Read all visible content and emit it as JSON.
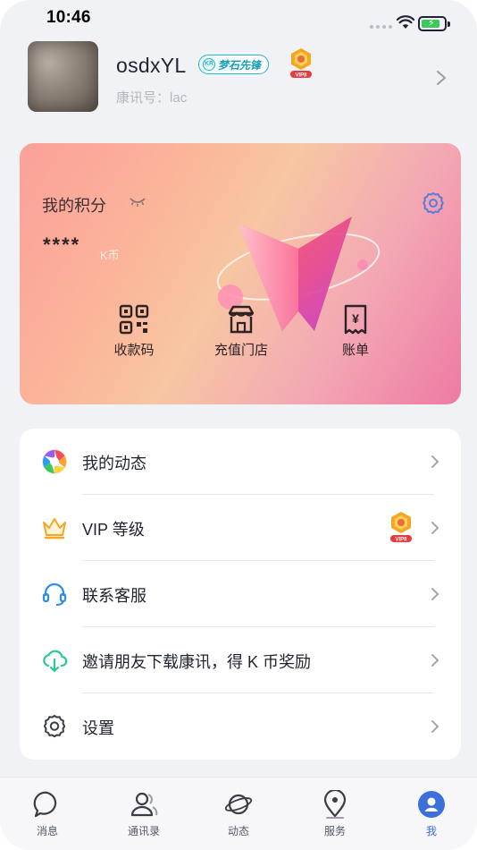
{
  "status_bar": {
    "time": "10:46"
  },
  "profile": {
    "username": "osdxYL",
    "badge_pioneer_label": "梦石先锋",
    "badge_pioneer_icon_text": "KR",
    "vip_badge_text": "VIP8",
    "account_label": "康讯号：",
    "account_value": "lac"
  },
  "points_card": {
    "title": "我的积分",
    "value": "****",
    "unit": "K币",
    "actions": [
      {
        "label": "收款码",
        "icon": "qr-code-icon"
      },
      {
        "label": "充值门店",
        "icon": "store-icon"
      },
      {
        "label": "账单",
        "icon": "receipt-icon"
      }
    ]
  },
  "menu": {
    "items": [
      {
        "label": "我的动态",
        "icon": "aperture-icon"
      },
      {
        "label": "VIP 等级",
        "icon": "crown-icon",
        "badge": "VIP8"
      },
      {
        "label": "联系客服",
        "icon": "headset-icon"
      },
      {
        "label": "邀请朋友下载康讯，得 K 币奖励",
        "icon": "cloud-download-icon"
      },
      {
        "label": "设置",
        "icon": "gear-icon"
      }
    ]
  },
  "tabbar": {
    "tabs": [
      {
        "label": "消息",
        "icon": "chat-icon"
      },
      {
        "label": "通讯录",
        "icon": "contacts-icon"
      },
      {
        "label": "动态",
        "icon": "planet-icon"
      },
      {
        "label": "服务",
        "icon": "location-icon"
      },
      {
        "label": "我",
        "icon": "me-icon",
        "active": true
      }
    ]
  },
  "colors": {
    "accent": "#3b6fd9",
    "card_gradient_start": "#fba09a",
    "card_gradient_end": "#ee7aa3",
    "background": "#f1f2f6",
    "vip_orange": "#f5a623"
  }
}
